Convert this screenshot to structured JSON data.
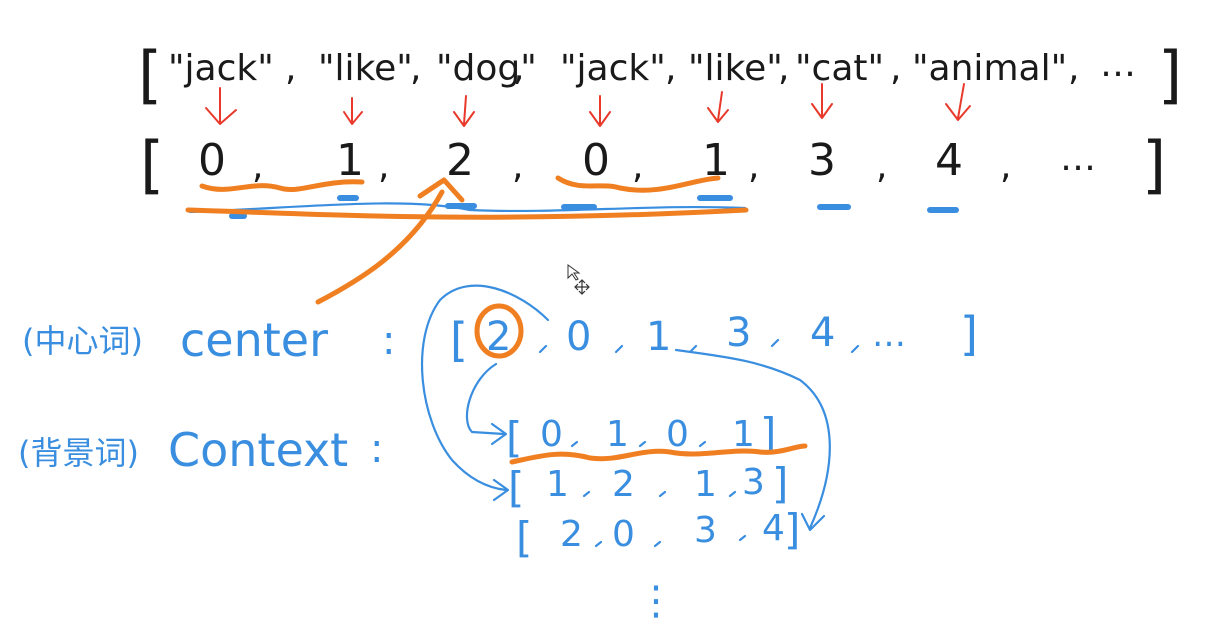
{
  "words": {
    "open": "[",
    "close": "]",
    "items": [
      "\"jack\"",
      "\"like\"",
      "\"dog\"",
      "\"jack\"",
      "\"like\"",
      "\"cat\"",
      "\"animal\""
    ],
    "separator": ",",
    "ellipsis": "…"
  },
  "indices": {
    "open": "[",
    "close": "]",
    "items": [
      "0",
      "1",
      "2",
      "0",
      "1",
      "3",
      "4"
    ],
    "separator": ",",
    "ellipsis": "…"
  },
  "center": {
    "label_cn": "(中心词)",
    "label": "center",
    "colon": ":",
    "open": "[",
    "close": "]",
    "items": [
      "2",
      "0",
      "1",
      "3",
      "4"
    ],
    "ellipsis": "…"
  },
  "context": {
    "label_cn": "(背景词)",
    "label": "Context",
    "colon": ":",
    "rows": [
      [
        "0",
        "1",
        "0",
        "1"
      ],
      [
        "1",
        "2",
        "1",
        "3"
      ],
      [
        "2",
        "0",
        "3",
        "4"
      ]
    ],
    "more": "⋮"
  },
  "colors": {
    "text": "#1a1a1a",
    "arrows": "#e8392a",
    "highlight": "#f07f22",
    "annotation": "#3a8ee0"
  }
}
